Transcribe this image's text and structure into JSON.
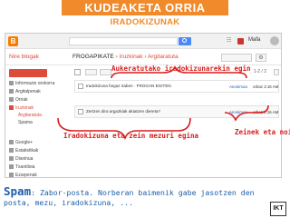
{
  "slide": {
    "title": "KUDEAKETA ORRIA",
    "subtitle": "IRADOKIZUNAK"
  },
  "topbar": {
    "blogger_logo": "B",
    "apps_glyph": "☷",
    "user_name": "Mafa"
  },
  "blog_header": {
    "my_blogs": "Nire blogak",
    "blog_name": "FROGAPIKATE",
    "breadcrumb": "› Iruzkinak › Argitaratuta",
    "settings_glyph": "⚙"
  },
  "sidebar": {
    "items": [
      {
        "label": "Informazio orokorra"
      },
      {
        "label": "Argitalpenak"
      },
      {
        "label": "Orriak"
      },
      {
        "label": "Iruzkinak"
      },
      {
        "label": "Argitaratuta"
      },
      {
        "label": "Spama"
      },
      {
        "label": "Google+"
      },
      {
        "label": "Estatistikak"
      },
      {
        "label": "Diseinua"
      },
      {
        "label": "Txantiloia"
      },
      {
        "label": "Ezarpenak"
      }
    ]
  },
  "toolbar": {
    "pager": "1-2 / 2"
  },
  "comments": [
    {
      "text": "Iradokizuna hegaz iraben · FROGAN EGITEN",
      "author": "Anonimoa",
      "when": "orbaz 2:16 AM"
    },
    {
      "text": "Zertzen dira argazkiak aktatzen diereta?",
      "author": "Anonimoa",
      "when": "orbaz 2:16 AM"
    }
  ],
  "annotations": {
    "top": "Aukeratutako iradokizunarekin egin",
    "bottom": "Iradokizuna eta zein mezuri egina",
    "right": "Zeinek eta noiz"
  },
  "caption": {
    "keyword": "Spam",
    "text": ": Zabor-posta. Norberan baimenik gabe jasotzen den posta, mezu, iradokizuna, ..."
  },
  "corner_logo": "IKT",
  "colors": {
    "orange": "#f08a2a",
    "annotation_red": "#d81d1d",
    "caption_blue": "#1f5fa8",
    "blogger_red": "#dd4b39"
  }
}
